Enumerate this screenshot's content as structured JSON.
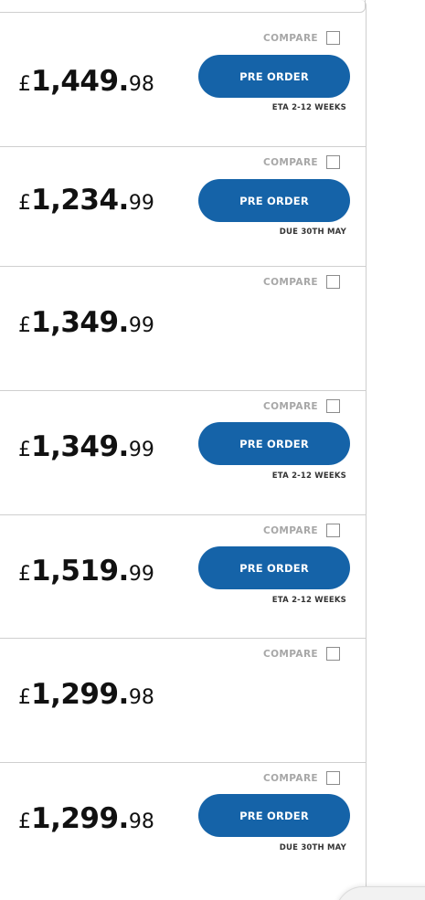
{
  "compare_label": "COMPARE",
  "currency": "£",
  "button_color": "#1563a8",
  "products": [
    {
      "whole": "1,449.",
      "pence": "98",
      "button": "PRE ORDER",
      "note": "ETA 2-12 WEEKS"
    },
    {
      "whole": "1,234.",
      "pence": "99",
      "button": "PRE ORDER",
      "note": "DUE 30TH MAY"
    },
    {
      "whole": "1,349.",
      "pence": "99",
      "button": null,
      "note": null
    },
    {
      "whole": "1,349.",
      "pence": "99",
      "button": "PRE ORDER",
      "note": "ETA 2-12 WEEKS"
    },
    {
      "whole": "1,519.",
      "pence": "99",
      "button": "PRE ORDER",
      "note": "ETA 2-12 WEEKS"
    },
    {
      "whole": "1,299.",
      "pence": "98",
      "button": null,
      "note": null
    },
    {
      "whole": "1,299.",
      "pence": "98",
      "button": "PRE ORDER",
      "note": "DUE 30TH MAY"
    }
  ]
}
